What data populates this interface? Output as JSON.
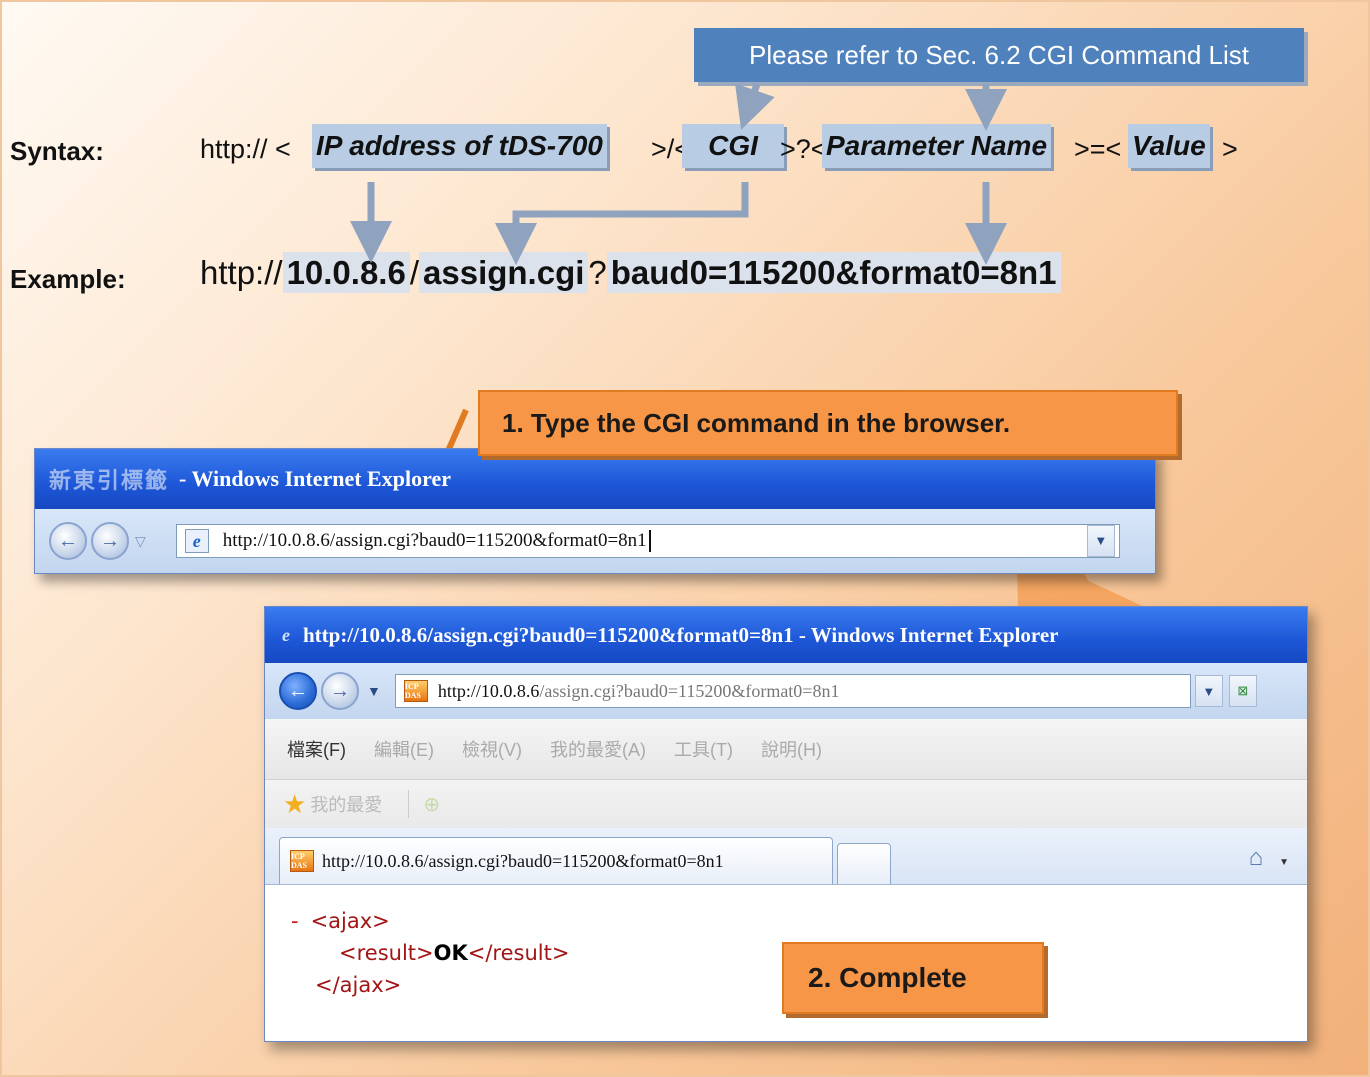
{
  "reference_note": "Please refer to Sec. 6.2 CGI Command List",
  "syntax": {
    "label": "Syntax:",
    "prefix": "http:// <",
    "ip_placeholder": "IP address of tDS-700",
    "sep1": ">/<",
    "cgi_placeholder": "CGI",
    "sep2": ">?<",
    "param_placeholder": "Parameter Name",
    "sep3": ">=<",
    "value_placeholder": "Value",
    "suffix": ">"
  },
  "example": {
    "label": "Example:",
    "prefix": "http://",
    "ip": "10.0.8.6",
    "slash": "/",
    "cgi": "assign.cgi",
    "qmark": "?",
    "params": "baud0=115200&format0=8n1"
  },
  "callouts": {
    "step1": "1.  Type the CGI command in the browser.",
    "step2": "2.  Complete"
  },
  "browser1": {
    "title_blurred": "新東引標籤",
    "title_suffix": "- Windows Internet Explorer",
    "address": "http://10.0.8.6/assign.cgi?baud0=115200&format0=8n1"
  },
  "browser2": {
    "title": "http://10.0.8.6/assign.cgi?baud0=115200&format0=8n1 - Windows Internet Explorer",
    "address_host": "http://10.0.8.6",
    "address_path": "/assign.cgi?baud0=115200&format0=8n1",
    "menu": [
      "檔案(F)",
      "編輯(E)",
      "檢視(V)",
      "我的最愛(A)",
      "工具(T)",
      "說明(H)"
    ],
    "favorites_label": "我的最愛",
    "tab_label": "http://10.0.8.6/assign.cgi?baud0=115200&format0=8n1",
    "favicon_text": "ICP DAS",
    "xml": {
      "collapse": "-",
      "open_tag": "<ajax>",
      "result_open": "<result>",
      "result_value": "OK",
      "result_close": "</result>",
      "close_tag": "</ajax>"
    }
  },
  "colors": {
    "reference_box": "#4f81bd",
    "highlight": "#b8cce4",
    "callout": "#f79646",
    "arrow": "#8fa3bf"
  }
}
